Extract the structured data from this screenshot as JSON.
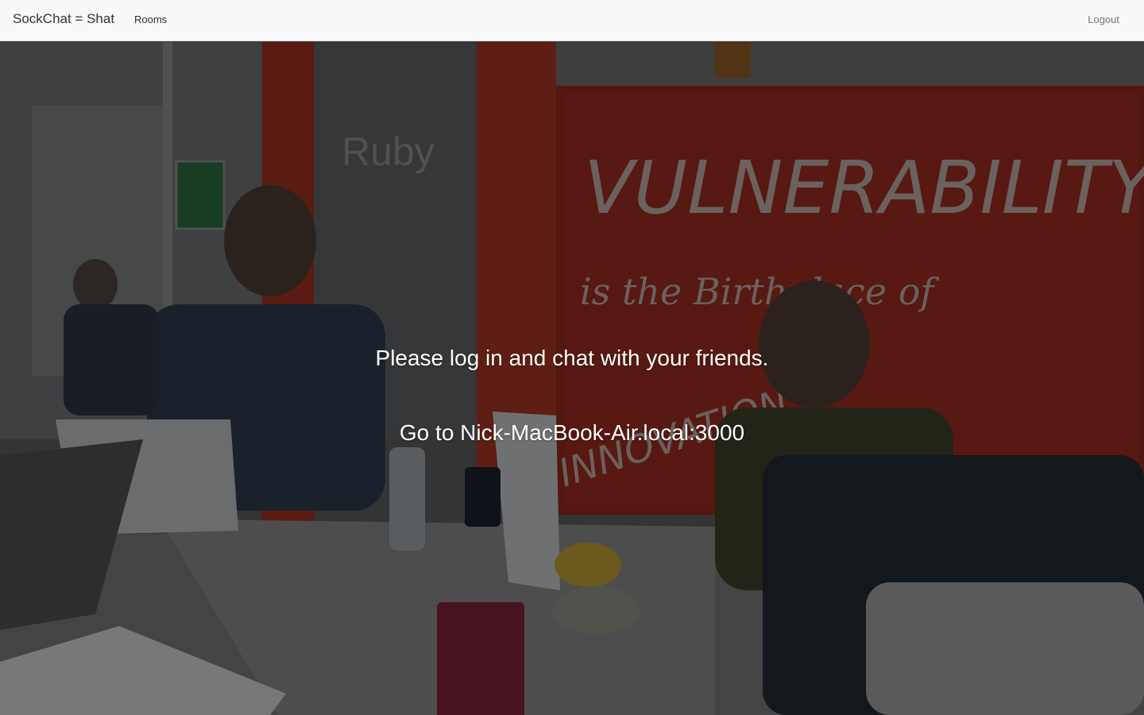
{
  "navbar": {
    "brand": "SockChat = Shat",
    "links": [
      {
        "label": "Rooms"
      }
    ],
    "logout_label": "Logout"
  },
  "hero": {
    "image_sign_text": "VULNERABILITY",
    "image_sign_line2": "is the Birthplace of",
    "image_sign_line3": "INNOVATION",
    "image_room_label": "Ruby",
    "messages": [
      "Please log in and chat with your friends.",
      "Go to Nick-MacBook-Air.local:3000"
    ]
  },
  "colors": {
    "navbar_bg": "#f8f8f8",
    "overlay_text": "#ffffff",
    "sign_red": "#c8371f"
  }
}
